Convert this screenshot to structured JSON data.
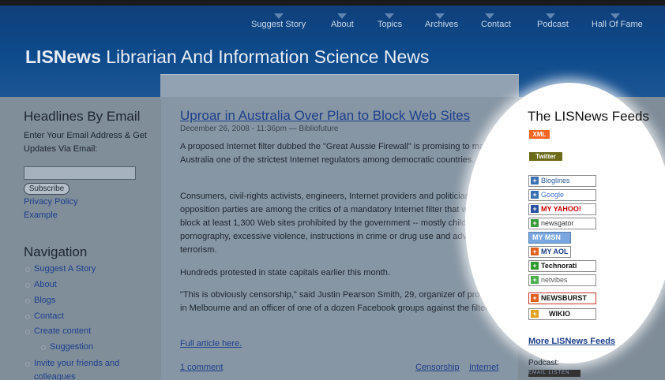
{
  "header": {
    "nav": [
      "Suggest Story",
      "About",
      "Topics",
      "Archives",
      "Contact",
      "Podcast",
      "Hall Of Fame"
    ],
    "title_bold": "LISNews",
    "title_rest": " Librarian And Information Science News"
  },
  "left": {
    "headlines_heading": "Headlines By Email",
    "email_prompt": "Enter Your Email Address & Get Updates Via Email:",
    "subscribe_label": "Subscribe",
    "privacy": "Privacy Policy",
    "example": "Example",
    "navigation_heading": "Navigation",
    "nav_items": [
      "Suggest A Story",
      "About",
      "Blogs",
      "Contact",
      "Create content",
      "Suggestion",
      "Invite your friends and",
      "colleagues"
    ]
  },
  "article": {
    "title": "Uproar in Australia Over Plan to Block Web Sites",
    "date": "December 26, 2008 - 11:36pm — Bibliofuture",
    "p1": "A proposed Internet filter dubbed the \"Great Aussie Firewall\" is promising to make Australia one of the strictest Internet regulators among democratic countries.",
    "p2": "Consumers, civil-rights activists, engineers, Internet providers and politicians from opposition parties are among the critics of a mandatory Internet filter that would block at least 1,300 Web sites prohibited by the government -- mostly child pornography, excessive violence, instructions in crime or drug use and advocacy of terrorism.",
    "p3": "Hundreds protested in state capitals earlier this month.",
    "p4": "\"This is obviously censorship,\" said Justin Pearson Smith, 29, organizer of protests in Melbourne and an officer of one of a dozen Facebook groups against the filter.",
    "full_article": "Full article here.",
    "comments": "1 comment",
    "tags": [
      "Censorship",
      "Internet"
    ]
  },
  "feeds": {
    "heading": "The LISNews Feeds",
    "xml": "XML",
    "twitter": "Twitter",
    "buttons": [
      "Bloglines",
      "Google",
      "MY YAHOO!",
      "newsgator",
      "MY MSN",
      "MY AOL",
      "Technorati",
      "netvibes",
      "NEWSBURST",
      "WIKIO"
    ],
    "more": "More LISNews Feeds",
    "podcast": "Podcast:",
    "podcast_badge": "EMAIL  LISTEN"
  },
  "colors": {
    "header_blue": "#0e4b8c",
    "link_blue": "#1d3f8c",
    "xml_orange": "#f26522",
    "twitter_olive": "#6b6b1a"
  }
}
